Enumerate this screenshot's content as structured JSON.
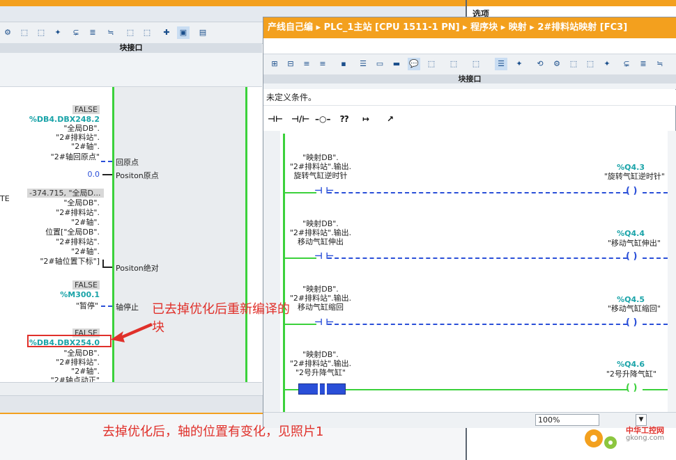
{
  "left_panel": {
    "block_interface": "块接口",
    "rows": [
      {
        "value": "FALSE",
        "addr": "%DB4.DBX248.2",
        "lines": [
          "\"全局DB\".",
          "\"2#排料站\".",
          "\"2#轴\".",
          "\"2#轴回原点\""
        ],
        "pin": "回原点"
      },
      {
        "value": "0.0",
        "pin": "Positon原点"
      },
      {
        "value": "-374.715, \"全局D...",
        "lines": [
          "\"全局DB\".",
          "\"2#排料站\".",
          "\"2#轴\".",
          "位置[\"全局DB\".",
          "\"2#排料站\".",
          "\"2#轴\".",
          "\"2#轴位置下标\"]"
        ],
        "pin": "Positon绝对",
        "left_label": "TE"
      },
      {
        "value": "FALSE",
        "addr": "%M300.1",
        "lines": [
          "\"暂停\""
        ],
        "pin": "轴停止"
      },
      {
        "value": "FALSE",
        "addr": "%DB4.DBX254.0",
        "lines": [
          "\"全局DB\".",
          "\"2#排料站\".",
          "\"2#轴\".",
          "\"2#轴点动正\""
        ]
      }
    ]
  },
  "right_panel": {
    "selection_label": "选项"
  },
  "window": {
    "title": "产线自己编 ▸ PLC_1主站 [CPU 1511-1 PN] ▸ 程序块 ▸ 映射 ▸ 2#排料站映射 [FC3]",
    "block_interface": "块接口",
    "no_condition": "未定义条件。",
    "lad_buttons": [
      "⊣⊢",
      "⊣/⊢",
      "–○–",
      "⁇",
      "↦",
      "↗"
    ],
    "networks": [
      {
        "var_lines": [
          "\"映射DB\".",
          "\"2#排料站\".输出.",
          "旋转气缸逆时针"
        ],
        "coil_addr": "%Q4.3",
        "coil_name": "\"旋转气缸逆时针\""
      },
      {
        "var_lines": [
          "\"映射DB\".",
          "\"2#排料站\".输出.",
          "移动气缸伸出"
        ],
        "coil_addr": "%Q4.4",
        "coil_name": "\"移动气缸伸出\""
      },
      {
        "var_lines": [
          "\"映射DB\".",
          "\"2#排料站\".输出.",
          "移动气缸缩回"
        ],
        "coil_addr": "%Q4.5",
        "coil_name": "\"移动气缸缩回\""
      },
      {
        "var_lines": [
          "\"映射DB\".",
          "\"2#排料站\".输出.",
          "\"2号升降气缸\""
        ],
        "coil_addr": "%Q4.6",
        "coil_name": "\"2号升降气缸\""
      }
    ],
    "zoom": "100%"
  },
  "annotations": {
    "note1": "已去掉优化后重新编译的块",
    "note2": "去掉优化后，轴的位置有变化，见照片1"
  },
  "watermark": {
    "line1": "中华工控网",
    "line2": "gkong.com"
  },
  "colors": {
    "accent_orange": "#f3a01e",
    "energized_green": "#3bd13b",
    "unpowered_blue": "#2a4fd8",
    "annotation_red": "#e0302a",
    "address_teal": "#19a3a8"
  }
}
